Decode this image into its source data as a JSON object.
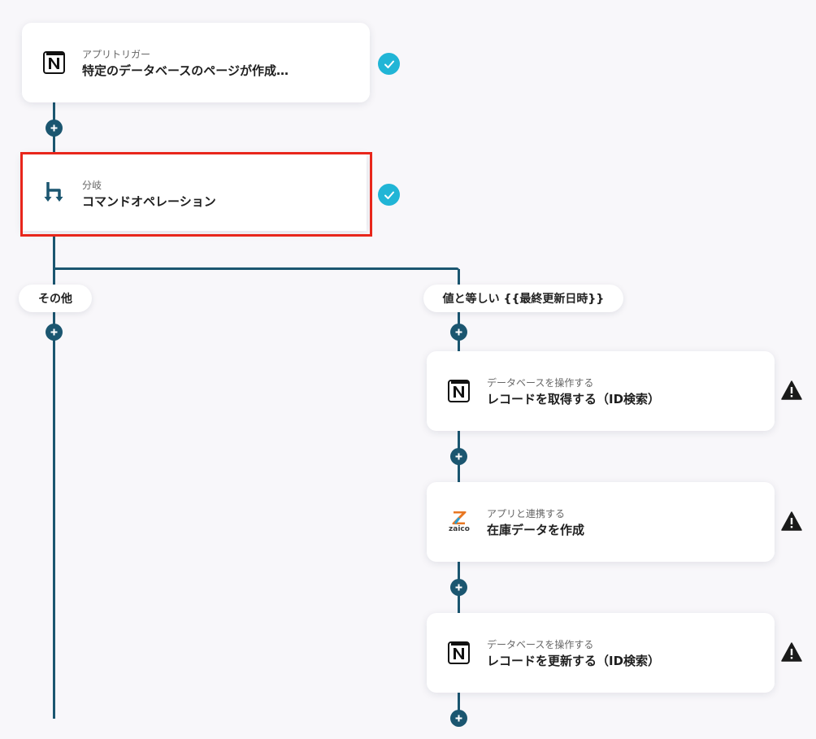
{
  "steps": [
    {
      "subtitle": "アプリトリガー",
      "title": "特定のデータベースのページが作成…",
      "icon": "notion-icon",
      "status": "complete"
    },
    {
      "subtitle": "分岐",
      "title": "コマンドオペレーション",
      "icon": "branch-icon",
      "status": "complete"
    },
    {
      "subtitle": "データベースを操作する",
      "title": "レコードを取得する（ID検索）",
      "icon": "notion-icon",
      "status": "warning"
    },
    {
      "subtitle": "アプリと連携する",
      "title": "在庫データを作成",
      "icon": "zaico-icon",
      "status": "warning"
    },
    {
      "subtitle": "データベースを操作する",
      "title": "レコードを更新する（ID検索）",
      "icon": "notion-icon",
      "status": "warning"
    }
  ],
  "branches": {
    "left": "その他",
    "right": "値と等しい {{最終更新日時}}"
  },
  "zaico_logo_text": "zaico",
  "colors": {
    "connector": "#1b5670",
    "check": "#21b5d6",
    "highlight": "#e8261b"
  }
}
